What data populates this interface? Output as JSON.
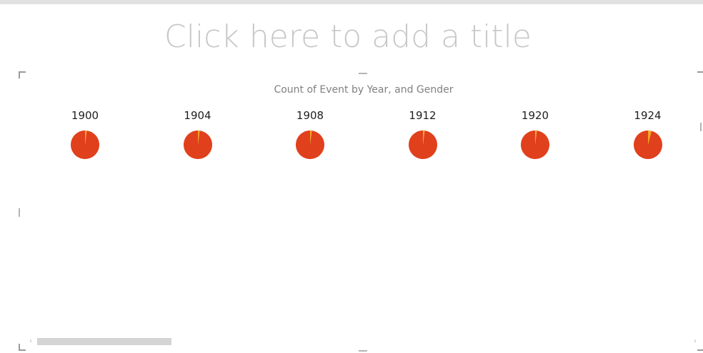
{
  "report": {
    "title_placeholder": "Click here to add a title"
  },
  "visual": {
    "subtitle": "Count of Event by Year, and Gender"
  },
  "colors": {
    "primary_slice": "#e0401c",
    "secondary_slice": "#f5a623",
    "title_placeholder": "#c8c8c8"
  },
  "chart_data": {
    "type": "pie",
    "title": "Count of Event by Year, and Gender",
    "small_multiples_by": "Year",
    "legend": "none",
    "multiples": [
      {
        "year": "1900",
        "slices": [
          {
            "name": "",
            "value": 0.98
          },
          {
            "name": "",
            "value": 0.02
          }
        ]
      },
      {
        "year": "1904",
        "slices": [
          {
            "name": "",
            "value": 0.98
          },
          {
            "name": "",
            "value": 0.02
          }
        ]
      },
      {
        "year": "1908",
        "slices": [
          {
            "name": "",
            "value": 0.98
          },
          {
            "name": "",
            "value": 0.02
          }
        ]
      },
      {
        "year": "1912",
        "slices": [
          {
            "name": "",
            "value": 0.98
          },
          {
            "name": "",
            "value": 0.02
          }
        ]
      },
      {
        "year": "1920",
        "slices": [
          {
            "name": "",
            "value": 0.98
          },
          {
            "name": "",
            "value": 0.02
          }
        ]
      },
      {
        "year": "1924",
        "slices": [
          {
            "name": "",
            "value": 0.96
          },
          {
            "name": "",
            "value": 0.04
          }
        ]
      }
    ]
  }
}
